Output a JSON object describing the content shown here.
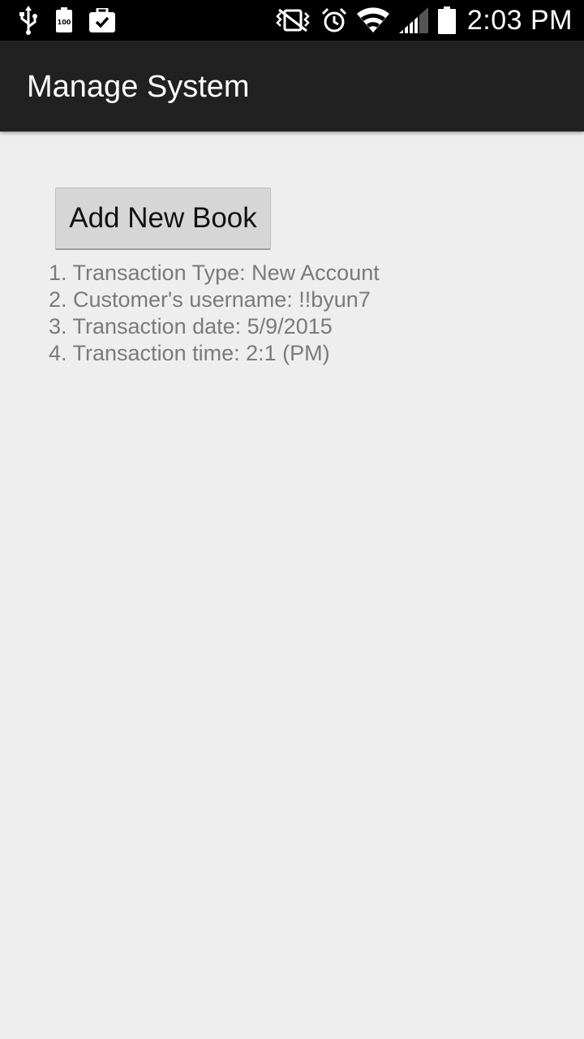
{
  "status_bar": {
    "time": "2:03 PM",
    "left_icons": [
      "usb-icon",
      "battery-100-icon",
      "briefcase-check-icon"
    ],
    "right_icons": [
      "vibrate-mute-icon",
      "alarm-icon",
      "wifi-icon",
      "signal-icon",
      "battery-icon"
    ],
    "battery_badge": "100"
  },
  "action_bar": {
    "title": "Manage System"
  },
  "main": {
    "add_book_button": "Add New Book",
    "transaction_lines": [
      "1. Transaction Type: New Account",
      "2. Customer's username: !!byun7",
      "3. Transaction date: 5/9/2015",
      "4. Transaction time: 2:1 (PM)"
    ]
  },
  "colors": {
    "status_bar_bg": "#000000",
    "action_bar_bg": "#212121",
    "content_bg": "#eeeeee",
    "button_bg": "#d6d6d6",
    "info_text": "#7a7a7a"
  }
}
